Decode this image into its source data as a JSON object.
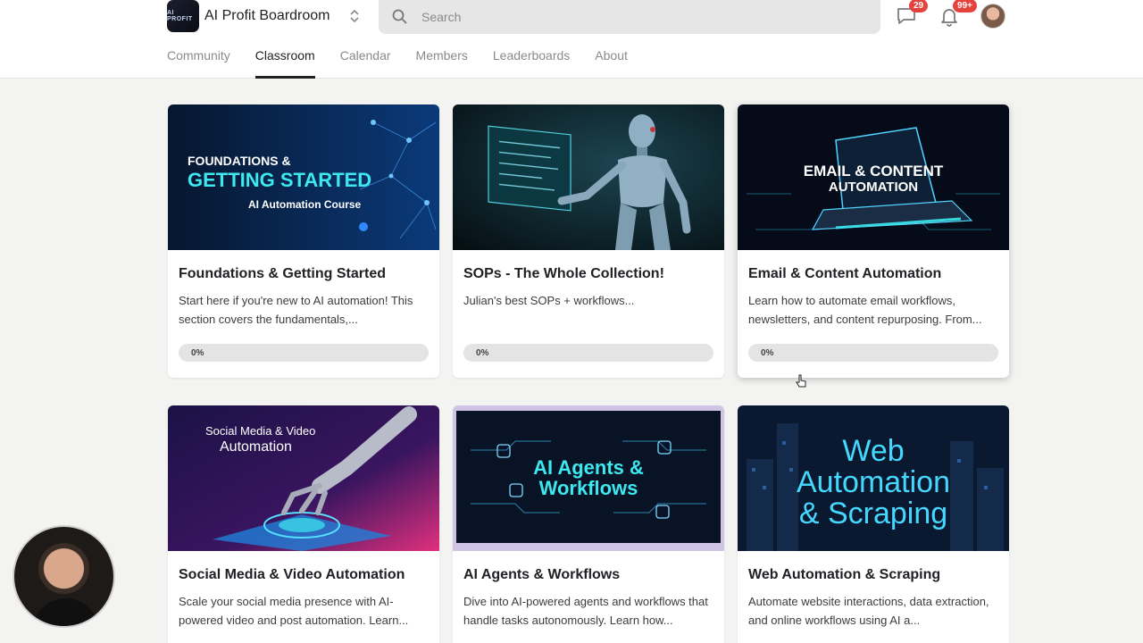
{
  "header": {
    "community_name": "AI Profit Boardroom",
    "logo_text": "AI PROFIT",
    "search_placeholder": "Search",
    "chat_badge": "29",
    "notifications_badge": "99+"
  },
  "tabs": [
    {
      "label": "Community",
      "active": false
    },
    {
      "label": "Classroom",
      "active": true
    },
    {
      "label": "Calendar",
      "active": false
    },
    {
      "label": "Members",
      "active": false
    },
    {
      "label": "Leaderboards",
      "active": false
    },
    {
      "label": "About",
      "active": false
    }
  ],
  "courses": [
    {
      "title": "Foundations & Getting Started",
      "description": "Start here if you're new to AI automation! This section covers the fundamentals,...",
      "progress": "0%",
      "thumb": {
        "line1": "FOUNDATIONS &",
        "line2": "GETTING STARTED",
        "line3": "AI Automation Course"
      }
    },
    {
      "title": "SOPs - The Whole Collection!",
      "description": "Julian's best SOPs + workflows...",
      "progress": "0%",
      "thumb": {}
    },
    {
      "title": "Email & Content Automation",
      "description": "Learn how to automate email workflows, newsletters, and content repurposing. From...",
      "progress": "0%",
      "thumb": {
        "line1": "EMAIL & CONTENT",
        "line2": "AUTOMATION"
      }
    },
    {
      "title": "Social Media & Video Automation",
      "description": "Scale your social media presence with AI-powered video and post automation. Learn...",
      "thumb": {
        "line1": "Social Media & Video",
        "line2": "Automation"
      }
    },
    {
      "title": "AI Agents & Workflows",
      "description": "Dive into AI-powered agents and workflows that handle tasks autonomously. Learn how...",
      "thumb": {
        "line1": "AI Agents &",
        "line2": "Workflows"
      }
    },
    {
      "title": "Web Automation & Scraping",
      "description": "Automate website interactions, data extraction, and online workflows using AI a...",
      "thumb": {
        "line1": "Web",
        "line2": "Automation",
        "line3": "& Scraping"
      }
    }
  ],
  "colors": {
    "accent_cyan": "#3de8ee",
    "badge_red": "#e5413d",
    "background": "#f3f3f1"
  }
}
